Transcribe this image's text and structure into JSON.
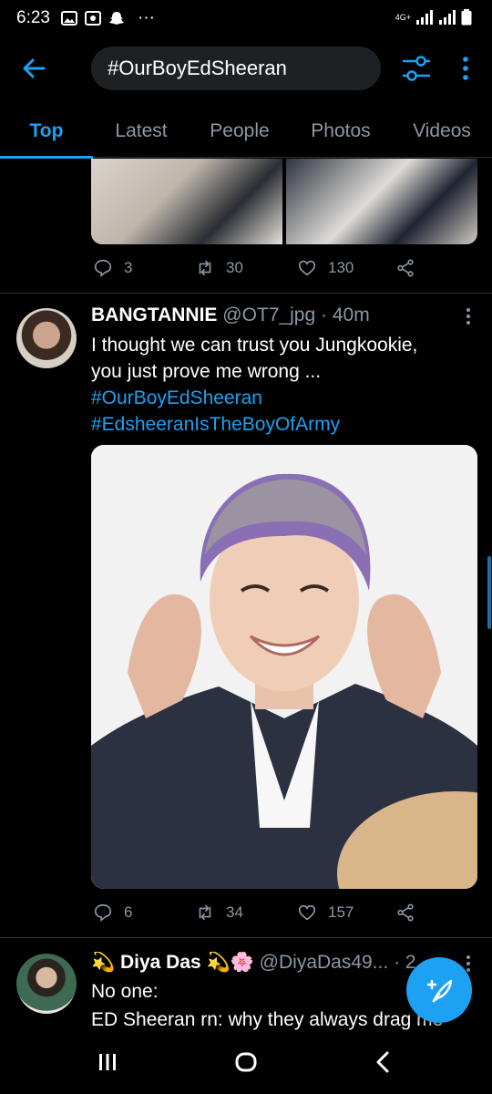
{
  "status_bar": {
    "time": "6:23",
    "dots": "···",
    "network": "4G+"
  },
  "search": {
    "query": "#OurBoyEdSheeran"
  },
  "tabs": [
    {
      "label": "Top",
      "active": true
    },
    {
      "label": "Latest",
      "active": false
    },
    {
      "label": "People",
      "active": false
    },
    {
      "label": "Photos",
      "active": false
    },
    {
      "label": "Videos",
      "active": false
    }
  ],
  "prev_tweet": {
    "replies": "3",
    "retweets": "30",
    "likes": "130"
  },
  "tweet": {
    "name": "BANGTANNIE",
    "handle": "@OT7_jpg",
    "time": "· 40m",
    "text_line1": "I thought we can trust you Jungkookie,",
    "text_line2": "you just prove me wrong ...",
    "hashtag1": "#OurBoyEdSheeran",
    "hashtag2": "#EdsheeranIsTheBoyOfArmy",
    "replies": "6",
    "retweets": "34",
    "likes": "157"
  },
  "tweet3": {
    "name": "💫 Diya Das 💫🌸",
    "handle": "@DiyaDas49...",
    "time": "· 2",
    "line1": "No one:",
    "line2": "ED Sheeran rn: why they always drag me"
  },
  "colors": {
    "accent": "#1da1f2",
    "background": "#000000",
    "muted": "#8b98a5"
  }
}
